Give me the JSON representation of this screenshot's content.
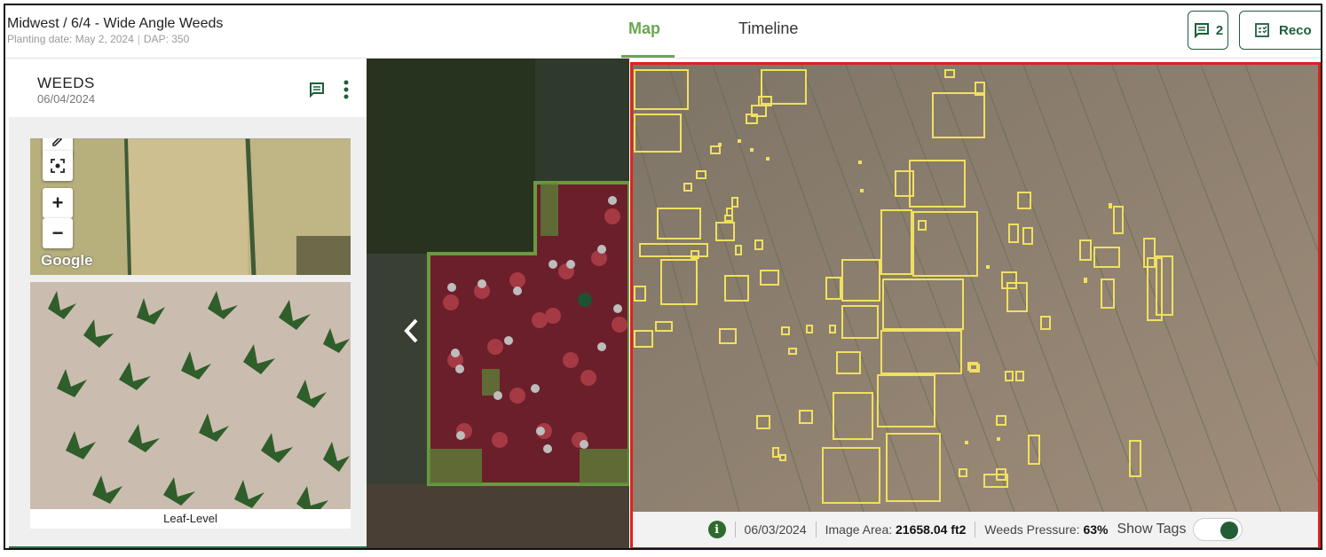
{
  "header": {
    "title": "Midwest / 6/4 - Wide Angle Weeds",
    "subtitle_date": "Planting date: May 2, 2024",
    "subtitle_dap": "DAP: 350",
    "tabs": [
      {
        "label": "Map",
        "active": true
      },
      {
        "label": "Timeline",
        "active": false
      }
    ],
    "comments_count": "2",
    "report_label": "Reco"
  },
  "left_panel": {
    "title": "WEEDS",
    "date": "06/04/2024",
    "map_zoom_in": "+",
    "map_zoom_out": "−",
    "map_attribution": "Google",
    "image_caption": "Leaf-Level"
  },
  "center_map": {
    "nav_icon": "chevron-left-icon"
  },
  "right_image": {
    "date": "06/03/2024",
    "image_area_label": "Image Area:",
    "image_area_value": "21658.04 ft2",
    "weeds_pressure_label": "Weeds Pressure:",
    "weeds_pressure_value": "63%",
    "show_tags_label": "Show Tags",
    "show_tags_on": true,
    "info_icon": "i"
  },
  "colors": {
    "accent": "#6aa84f",
    "brand_dark": "#1e5e3a",
    "highlight_border": "#e02020",
    "tag_box": "#f0e060",
    "field_overlay": "#6b1f2a"
  }
}
